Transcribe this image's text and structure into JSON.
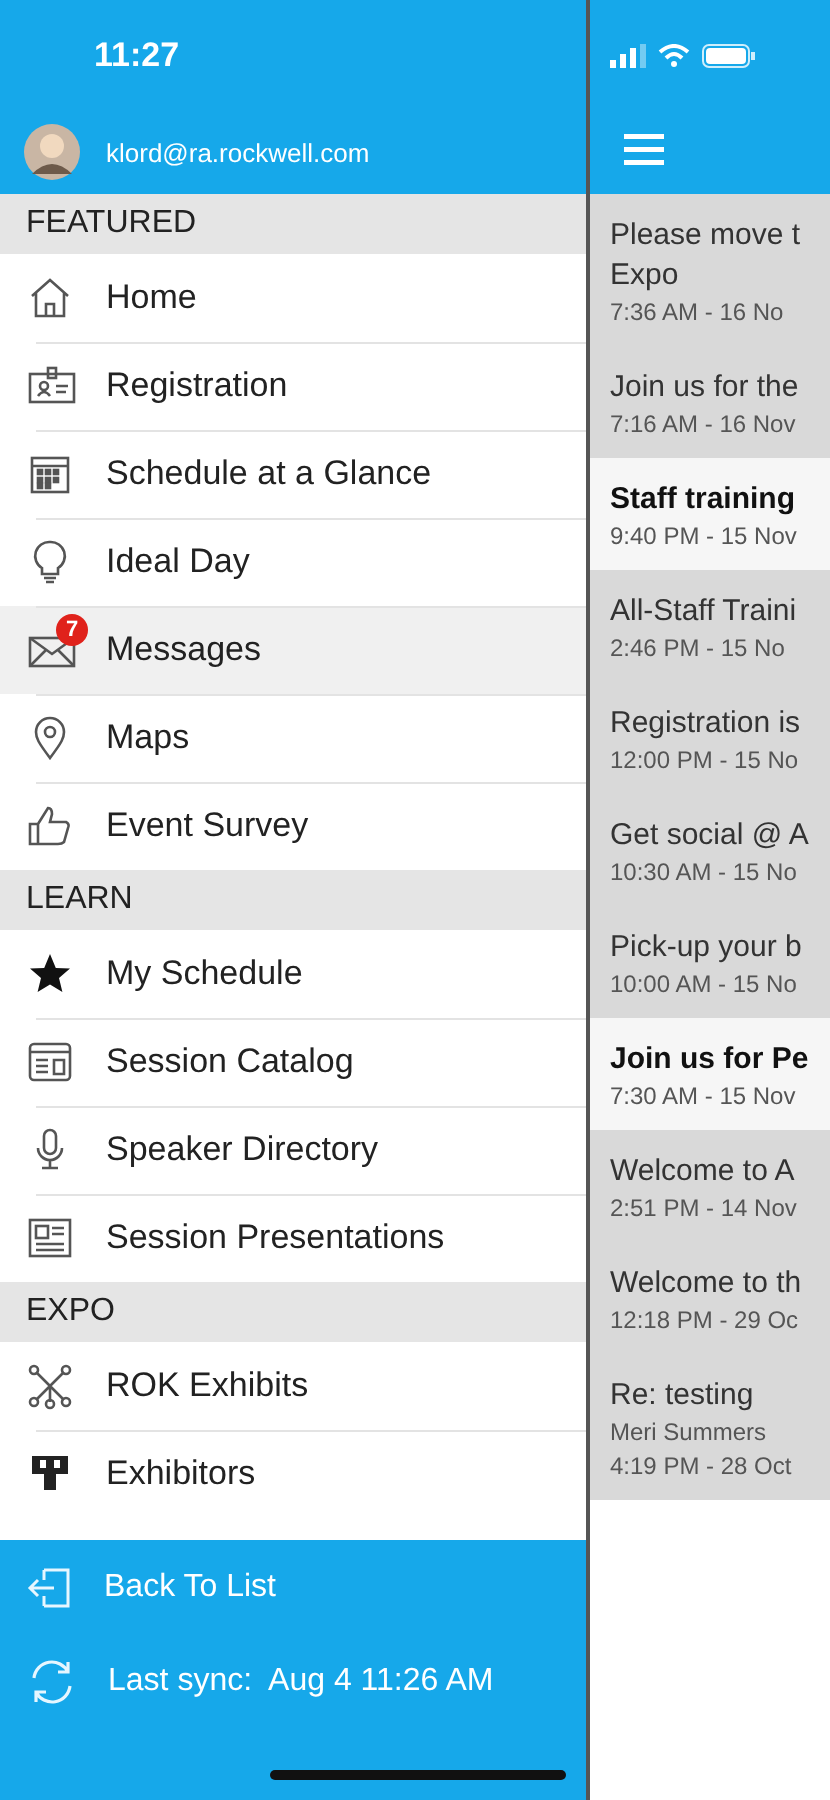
{
  "status_bar": {
    "time": "11:27"
  },
  "profile": {
    "email": "klord@ra.rockwell.com"
  },
  "sections": [
    {
      "title": "FEATURED",
      "items": [
        {
          "label": "Home",
          "kind": "home",
          "selected": false
        },
        {
          "label": "Registration",
          "kind": "badge",
          "selected": false
        },
        {
          "label": "Schedule at a Glance",
          "kind": "calendar",
          "selected": false
        },
        {
          "label": "Ideal Day",
          "kind": "bulb",
          "selected": false
        },
        {
          "label": "Messages",
          "kind": "mail",
          "selected": true,
          "badge": "7"
        },
        {
          "label": "Maps",
          "kind": "pin",
          "selected": false
        },
        {
          "label": "Event Survey",
          "kind": "thumb",
          "selected": false
        }
      ]
    },
    {
      "title": "LEARN",
      "items": [
        {
          "label": "My Schedule",
          "kind": "star",
          "selected": false
        },
        {
          "label": "Session Catalog",
          "kind": "catalog",
          "selected": false
        },
        {
          "label": "Speaker Directory",
          "kind": "mic",
          "selected": false
        },
        {
          "label": "Session Presentations",
          "kind": "presentation",
          "selected": false
        }
      ]
    },
    {
      "title": "EXPO",
      "items": [
        {
          "label": "ROK Exhibits",
          "kind": "network",
          "selected": false
        },
        {
          "label": "Exhibitors",
          "kind": "booth",
          "selected": false
        }
      ]
    }
  ],
  "footer": {
    "back": "Back To List",
    "sync_label": "Last sync:",
    "sync_time": "Aug 4 11:26 AM"
  },
  "messages": [
    {
      "title": "Please move t",
      "title_2": "Expo",
      "time": "7:36 AM - 16 No",
      "unread": false
    },
    {
      "title": "Join us for the",
      "time": "7:16 AM - 16 Nov",
      "unread": false
    },
    {
      "title": "Staff training",
      "time": "9:40 PM - 15 Nov",
      "unread": true
    },
    {
      "title": "All-Staff Traini",
      "time": "2:46 PM - 15 No",
      "unread": false
    },
    {
      "title": "Registration is",
      "time": "12:00 PM - 15 No",
      "unread": false
    },
    {
      "title": "Get social @ A",
      "time": "10:30 AM - 15 No",
      "unread": false
    },
    {
      "title": "Pick-up your b",
      "time": "10:00 AM - 15 No",
      "unread": false
    },
    {
      "title": "Join us for Pe",
      "time": "7:30 AM - 15 Nov",
      "unread": true
    },
    {
      "title": "Welcome to A",
      "time": "2:51 PM - 14 Nov",
      "unread": false
    },
    {
      "title": "Welcome to th",
      "time": "12:18 PM - 29 Oc",
      "unread": false
    },
    {
      "title": "Re: testing",
      "sender": "Meri Summers",
      "time": "4:19 PM - 28 Oct",
      "unread": false
    }
  ]
}
